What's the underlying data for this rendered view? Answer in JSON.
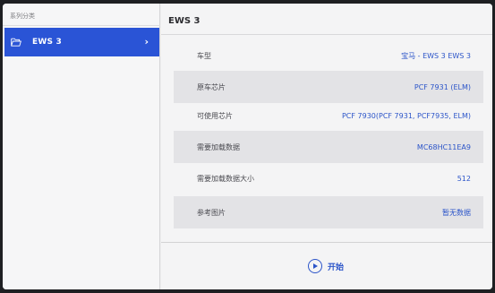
{
  "sidebar": {
    "title": "系列分类",
    "items": [
      {
        "label": "EWS 3",
        "icon": "folder-open-icon",
        "chevron": "›"
      }
    ]
  },
  "main": {
    "title": "EWS 3",
    "rows": [
      {
        "key": "车型",
        "value": "宝马 - EWS 3 EWS 3"
      },
      {
        "key": "原车芯片",
        "value": "PCF 7931 (ELM)"
      },
      {
        "key": "可使用芯片",
        "value": "PCF 7930(PCF 7931, PCF7935, ELM)"
      },
      {
        "key": "需要加载数据",
        "value": "MC68HC11EA9"
      },
      {
        "key": "需要加载数据大小",
        "value": "512"
      },
      {
        "key": "参考图片",
        "value": "暂无数据"
      }
    ]
  },
  "footer": {
    "start_label": "开始",
    "start_icon": "play-circle-icon"
  },
  "colors": {
    "accent": "#2a54d6",
    "value_text": "#2c55c9",
    "sidebar_bg": "#f6f6f7",
    "row_shade": "#e3e3e6"
  }
}
